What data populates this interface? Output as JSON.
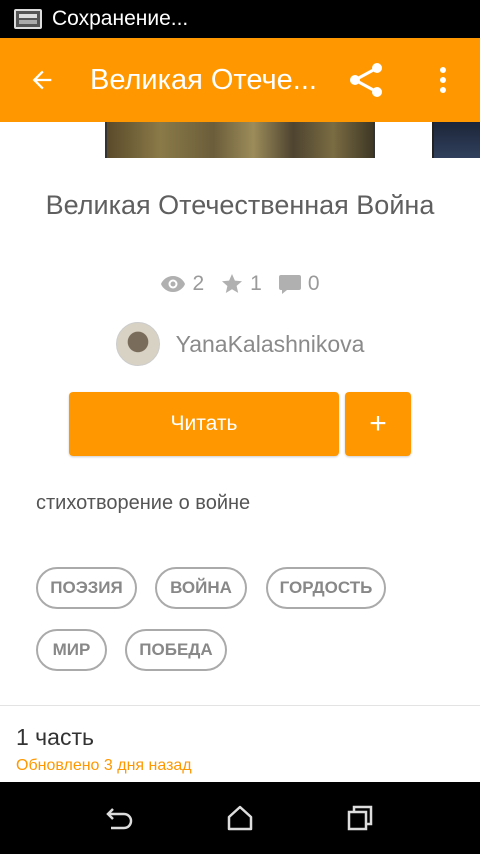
{
  "status_bar": {
    "text": "Сохранение..."
  },
  "app_bar": {
    "title": "Великая Отече...",
    "background": "#ff9800",
    "back_icon": "arrow-left-icon",
    "share_icon": "share-icon",
    "more_icon": "more-vert-icon"
  },
  "story": {
    "title": "Великая Отечественная Война",
    "stats": {
      "views": "2",
      "votes": "1",
      "comments": "0"
    },
    "author": "YanaKalashnikova",
    "read_label": "Читать",
    "add_label": "+",
    "description": "стихотворение о войне",
    "tags": [
      "ПОЭЗИЯ",
      "ВОЙНА",
      "ГОРДОСТЬ",
      "МИР",
      "ПОБЕДА"
    ]
  },
  "parts": {
    "title": "1 часть",
    "updated": "Обновлено 3 дня назад"
  },
  "colors": {
    "accent": "#ff9800",
    "text_muted": "#9a9a9a"
  }
}
